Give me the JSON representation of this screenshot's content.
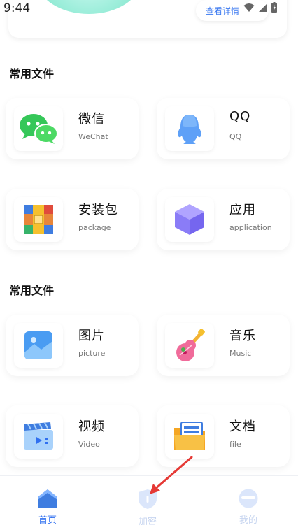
{
  "status_bar": {
    "time": "9:44"
  },
  "top_card": {
    "detail_label": "查看详情"
  },
  "sections": [
    {
      "title": "常用文件"
    },
    {
      "title": "常用文件"
    }
  ],
  "grid1": [
    {
      "title": "微信",
      "subtitle": "WeChat",
      "icon": "wechat-icon"
    },
    {
      "title": "QQ",
      "subtitle": "QQ",
      "icon": "qq-icon"
    },
    {
      "title": "安装包",
      "subtitle": "package",
      "icon": "package-icon"
    },
    {
      "title": "应用",
      "subtitle": "application",
      "icon": "application-icon"
    }
  ],
  "grid2": [
    {
      "title": "图片",
      "subtitle": "picture",
      "icon": "picture-icon"
    },
    {
      "title": "音乐",
      "subtitle": "Music",
      "icon": "music-icon"
    },
    {
      "title": "视频",
      "subtitle": "Video",
      "icon": "video-icon"
    },
    {
      "title": "文档",
      "subtitle": "file",
      "icon": "document-icon"
    }
  ],
  "bottom_nav": [
    {
      "label": "首页",
      "icon": "home-icon",
      "active": true
    },
    {
      "label": "加密",
      "icon": "shield-icon",
      "active": false
    },
    {
      "label": "我的",
      "icon": "profile-icon",
      "active": false
    }
  ],
  "colors": {
    "accent": "#2f6ff0",
    "inactive": "#c8d6f0",
    "annotation": "#e53935"
  }
}
